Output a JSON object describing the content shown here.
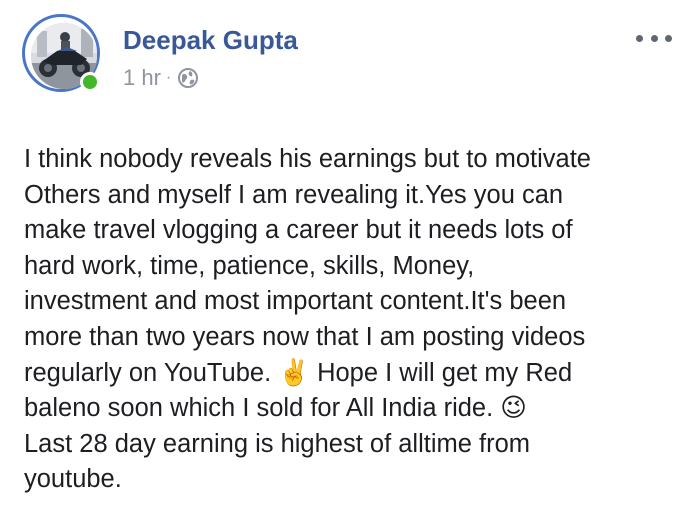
{
  "post": {
    "author": {
      "name": "Deepak Gupta",
      "status": "online"
    },
    "meta": {
      "timestamp": "1 hr",
      "separator": "·",
      "privacy_icon": "globe-icon"
    },
    "more_icon": "more-horizontal-icon",
    "text_lines": [
      "I think nobody reveals his earnings but to motivate",
      "Others and myself I am revealing it.Yes you can",
      "make travel vlogging a career but it needs lots of",
      "hard work, time, patience, skills, Money,",
      "investment and most important content.It's been",
      "more than two years now that I am posting videos",
      "regularly on YouTube. ✌️ Hope I will get my Red",
      "baleno soon which I sold for All India ride. 😉",
      "Last 28 day earning is highest of alltime from",
      "youtube."
    ]
  },
  "colors": {
    "author_name": "#385898",
    "meta_text": "#90949c",
    "avatar_ring": "#4a76c9",
    "online_dot": "#42b72a",
    "body_text": "#1c1e21"
  }
}
